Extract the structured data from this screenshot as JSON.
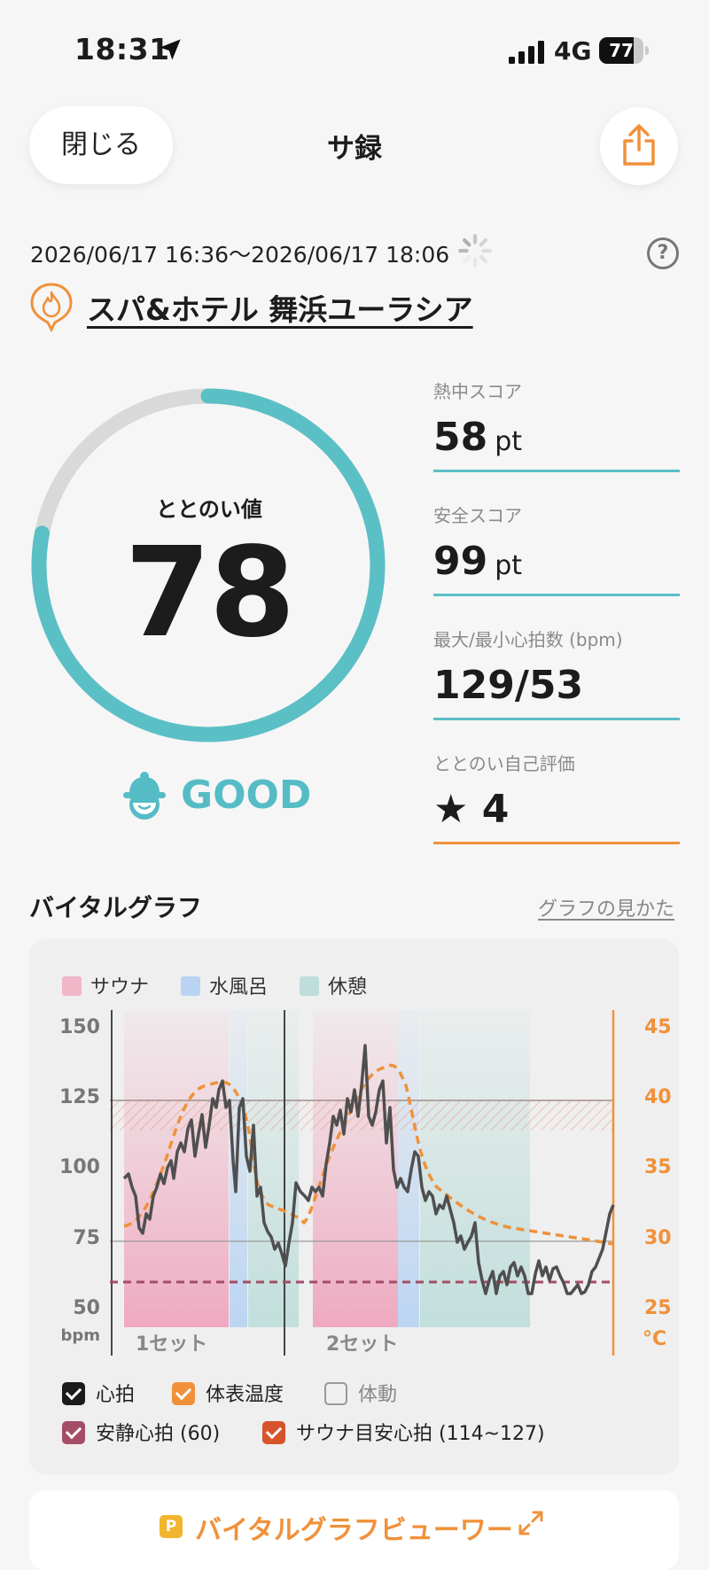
{
  "status_bar": {
    "time": "18:31",
    "network": "4G",
    "battery": "77",
    "battery_level": 0.77
  },
  "header": {
    "close_label": "閉じる",
    "title": "サ録",
    "share_icon": "share-icon"
  },
  "session": {
    "date_range": "2026/06/17 16:36〜2026/06/17 18:06",
    "location": "スパ&ホテル 舞浜ユーラシア",
    "help": "?"
  },
  "score": {
    "label": "ととのい値",
    "value": "78",
    "progress": 0.78,
    "rating": "GOOD",
    "accent": "#5bbfc6"
  },
  "stats": [
    {
      "label": "熱中スコア",
      "value": "58",
      "unit": "pt"
    },
    {
      "label": "安全スコア",
      "value": "99",
      "unit": "pt"
    },
    {
      "label": "最大/最小心拍数 (bpm)",
      "value": "129/53",
      "unit": ""
    },
    {
      "label": "ととのい自己評価",
      "value": "★ 4",
      "unit": ""
    }
  ],
  "graph_section": {
    "title": "バイタルグラフ",
    "link": "グラフの見かた",
    "legend": [
      {
        "label": "サウナ",
        "color": "#f1b6c8"
      },
      {
        "label": "水風呂",
        "color": "#b9d4f2"
      },
      {
        "label": "休憩",
        "color": "#bfdedb"
      }
    ],
    "left_axis": {
      "ticks": [
        "150",
        "125",
        "100",
        "75",
        "50"
      ],
      "unit": "bpm"
    },
    "right_axis": {
      "ticks": [
        "45",
        "40",
        "35",
        "30",
        "25"
      ],
      "unit": "°C"
    },
    "set_labels": [
      "1セット",
      "2セット"
    ],
    "checkboxes": [
      {
        "label": "心拍",
        "checked": true,
        "color": "#1a1a1a"
      },
      {
        "label": "体表温度",
        "checked": true,
        "color": "#f0913a"
      },
      {
        "label": "体動",
        "checked": false,
        "color": "#999999"
      },
      {
        "label": "安静心拍 (60)",
        "checked": true,
        "color": "#a54d66"
      },
      {
        "label": "サウナ目安心拍 (114~127)",
        "checked": true,
        "color": "#d7542a"
      }
    ]
  },
  "viewer": {
    "badge": "P",
    "label": "バイタルグラフビューワー"
  }
}
